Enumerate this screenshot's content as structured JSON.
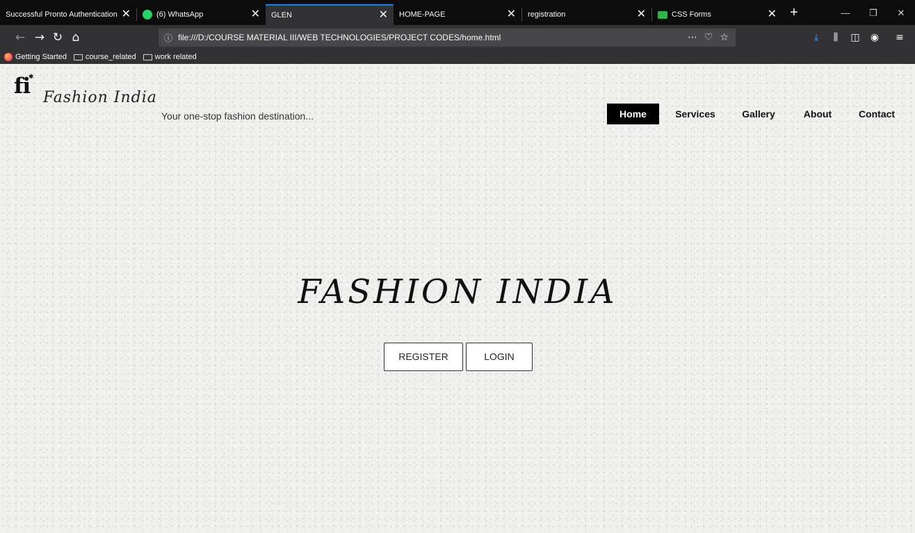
{
  "browser": {
    "tabs": [
      {
        "title": "Successful Pronto Authentication",
        "icon": "none"
      },
      {
        "title": "(6) WhatsApp",
        "icon": "whatsapp-icon"
      },
      {
        "title": "GLEN",
        "icon": "none",
        "active": true
      },
      {
        "title": "HOME-PAGE",
        "icon": "none"
      },
      {
        "title": "registration",
        "icon": "none"
      },
      {
        "title": "CSS Forms",
        "icon": "css-icon"
      }
    ],
    "close_glyph": "✕",
    "new_tab_glyph": "+",
    "window_controls": {
      "minimize": "—",
      "restore": "❐",
      "close": "✕"
    },
    "url": "file:///D:/COURSE MATERIAL III/WEB TECHNOLOGIES/PROJECT CODES/home.html",
    "bookmarks": [
      {
        "label": "Getting Started",
        "icon": "firefox-icon"
      },
      {
        "label": "course_related",
        "icon": "folder-icon"
      },
      {
        "label": "work related",
        "icon": "folder-icon"
      }
    ],
    "accent_color": "#0a84ff"
  },
  "site": {
    "logo_mark": "fi",
    "logo_name": "Fashion India",
    "tagline": "Your one-stop fashion destination...",
    "nav": [
      {
        "label": "Home",
        "active": true
      },
      {
        "label": "Services"
      },
      {
        "label": "Gallery"
      },
      {
        "label": "About"
      },
      {
        "label": "Contact"
      }
    ],
    "hero_title": "FASHION INDIA",
    "buttons": {
      "register": "REGISTER",
      "login": "LOGIN"
    }
  }
}
